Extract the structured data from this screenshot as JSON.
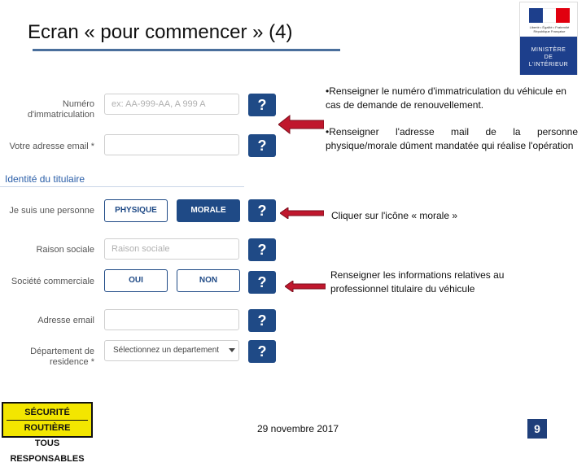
{
  "slide": {
    "title": "Ecran « pour commencer » (4)",
    "date": "29 novembre 2017",
    "page_number": "9"
  },
  "logo": {
    "motto": "Liberté • Égalité • Fraternité  République Française",
    "line1": "MINISTÈRE",
    "line2": "DE",
    "line3": "L'INTÉRIEUR",
    "flag_colors": [
      "#1d3f8c",
      "#ffffff",
      "#e1000f"
    ]
  },
  "badge": {
    "line1": "SÉCURITÉ ROUTIÈRE",
    "line2": "TOUS RESPONSABLES"
  },
  "form": {
    "numero_label_1": "Numéro",
    "numero_label_2": "d'immatriculation",
    "numero_placeholder": "ex: AA-999-AA, A 999 A",
    "email_label": "Votre adresse email *",
    "section_title": "Identité du titulaire",
    "personne_label": "Je suis une personne",
    "physique_label": "PHYSIQUE",
    "morale_label": "MORALE",
    "raison_label": "Raison sociale",
    "raison_placeholder": "Raison sociale",
    "societe_label": "Société commerciale",
    "oui_label": "OUI",
    "non_label": "NON",
    "adresse_label": "Adresse email",
    "departement_label_1": "Département de",
    "departement_label_2": "residence *",
    "departement_value": "Sélectionnez un departement",
    "help_glyph": "?"
  },
  "notes": {
    "note1": "•Renseigner le numéro d'immatriculation du véhicule en cas de demande de renouvellement.",
    "note2": "•Renseigner l'adresse mail de la personne physique/morale dûment mandatée qui réalise l'opération",
    "note3": "Cliquer sur l'icône « morale »",
    "note4": "Renseigner les informations relatives au professionnel titulaire du véhicule"
  },
  "colors": {
    "accent_blue": "#1f4a86",
    "arrow_red": "#c0172d",
    "badge_yellow": "#f3e600"
  }
}
